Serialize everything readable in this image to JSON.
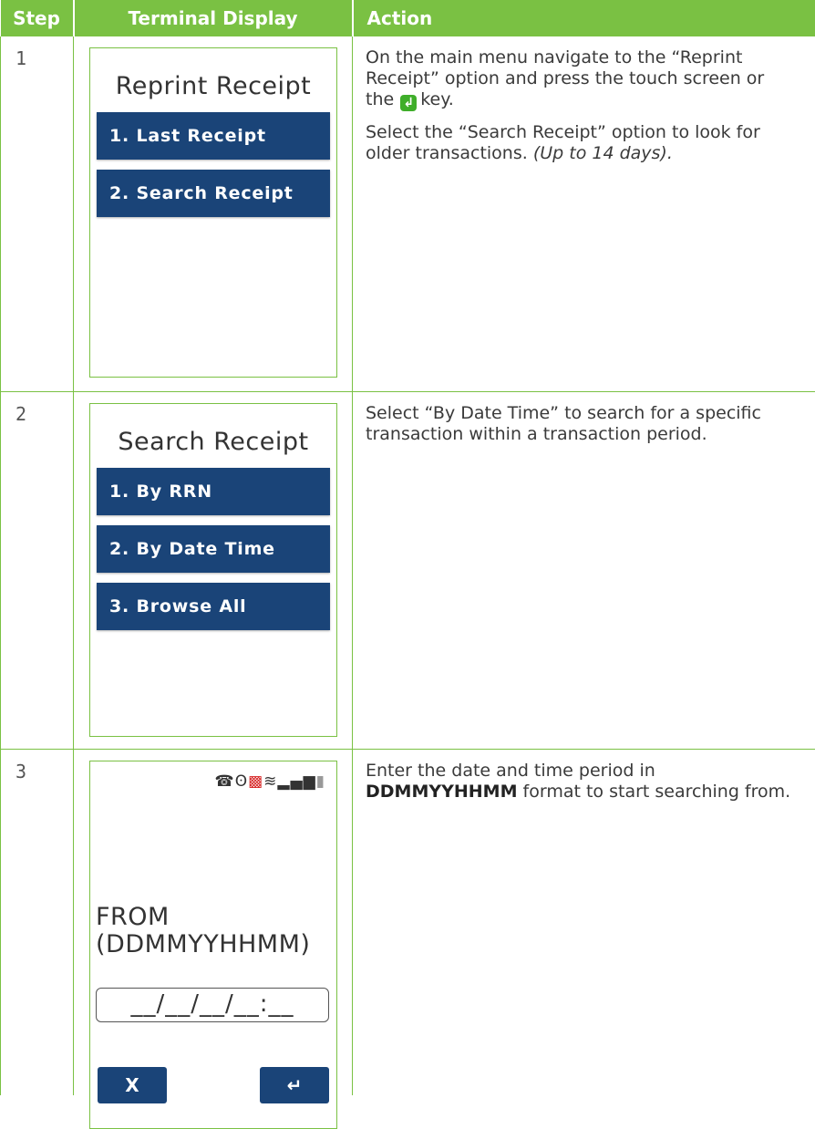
{
  "header": {
    "step": "Step",
    "terminal_display": "Terminal Display",
    "action": "Action"
  },
  "rows": [
    {
      "step": "1",
      "terminal": {
        "title": "Reprint Receipt",
        "buttons": [
          "1. Last Receipt",
          "2. Search Receipt"
        ]
      },
      "action": {
        "p1_part1": "On the main menu navigate to the “Reprint Receipt” option and press the touch screen or the",
        "p1_key_icon": "enter-key-icon",
        "p1_part2": "key.",
        "p2_part1": "Select the “Search Receipt” option to look for older transactions.",
        "p2_italic": "(Up to 14 days)."
      }
    },
    {
      "step": "2",
      "terminal": {
        "title": "Search Receipt",
        "buttons": [
          "1. By RRN",
          "2. By Date Time",
          "3. Browse All"
        ]
      },
      "action": {
        "p1": "Select “By Date Time” to search for a specific transaction within a transaction period."
      }
    },
    {
      "step": "3",
      "terminal": {
        "status_icons": [
          "phone-icon",
          "bluetooth-icon",
          "network-icon",
          "wifi-icon",
          "signal-icon",
          "battery-icon"
        ],
        "from_label": "FROM",
        "format_label": "(DDMMYYHHMM)",
        "date_field": "__/__/__/__:__",
        "cancel_key": "X",
        "enter_key": "↵"
      },
      "action": {
        "p1_part1": "Enter the date and time period in",
        "p1_bold": "DDMMYYHHMM",
        "p1_part2": "format to start searching from."
      }
    }
  ],
  "colors": {
    "header_green": "#7ac143",
    "button_navy": "#1a4478",
    "enter_key_green": "#3fae2a",
    "network_red": "#d62323"
  }
}
